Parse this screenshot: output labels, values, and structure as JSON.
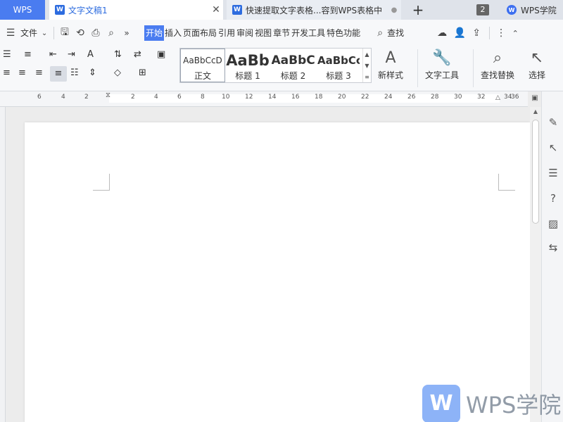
{
  "tabs": {
    "home": "WPS",
    "documents": [
      {
        "title": "文字文稿1",
        "active": true
      },
      {
        "title": "快速提取文字表格...容到WPS表格中",
        "active": false
      }
    ],
    "add_icon": "plus-icon",
    "window_count": "2",
    "academy": "WPS学院"
  },
  "menubar": {
    "file_label": "文件",
    "tabs": [
      "开始",
      "插入",
      "页面布局",
      "引用",
      "审阅",
      "视图",
      "章节",
      "开发工具",
      "特色功能"
    ],
    "active_tab": "开始",
    "search_label": "查找"
  },
  "ribbon": {
    "styles": [
      {
        "sample": "AaBbCcD",
        "name": "正文"
      },
      {
        "sample": "AaBb",
        "name": "标题 1"
      },
      {
        "sample": "AaBbC",
        "name": "标题 2"
      },
      {
        "sample": "AaBbCc",
        "name": "标题 3"
      }
    ],
    "new_style": "新样式",
    "text_tools": "文字工具",
    "find_replace": "查找替换",
    "select": "选择"
  },
  "ruler": {
    "numbers": [
      "6",
      "4",
      "2",
      "2",
      "4",
      "6",
      "8",
      "10",
      "12",
      "14",
      "16",
      "18",
      "20",
      "22",
      "24",
      "26",
      "28",
      "30",
      "32",
      "34",
      "36"
    ]
  },
  "watermark": {
    "text": "WPS学院"
  },
  "colors": {
    "accent": "#4a7cf0",
    "active_tab_text": "#2d6cdf"
  }
}
